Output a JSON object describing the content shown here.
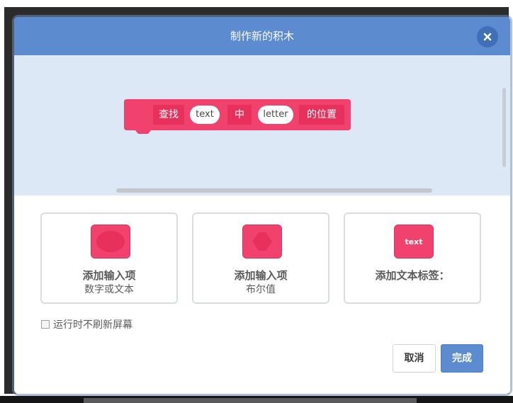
{
  "dialog": {
    "title": "制作新的积木",
    "close_icon": "close-icon"
  },
  "block": {
    "color": "#e8305c",
    "parts": [
      {
        "kind": "label",
        "text": "查找"
      },
      {
        "kind": "input",
        "text": "text"
      },
      {
        "kind": "label",
        "text": "中"
      },
      {
        "kind": "input",
        "text": "letter"
      },
      {
        "kind": "label",
        "text": "的位置"
      }
    ]
  },
  "options": [
    {
      "title": "添加输入项",
      "subtitle": "数字或文本",
      "icon": "round-input-icon"
    },
    {
      "title": "添加输入项",
      "subtitle": "布尔值",
      "icon": "hexagon-input-icon"
    },
    {
      "title": "添加文本标签：",
      "subtitle": "",
      "icon": "text-label-icon",
      "icon_text": "text"
    }
  ],
  "run_without_refresh": {
    "label": "运行时不刷新屏幕",
    "checked": false
  },
  "buttons": {
    "cancel": "取消",
    "done": "完成"
  },
  "colors": {
    "titlebar": "#5c8bd0",
    "block": "#e8305c",
    "option_icon": "#f0426c",
    "done_button": "#5c8bd0"
  }
}
